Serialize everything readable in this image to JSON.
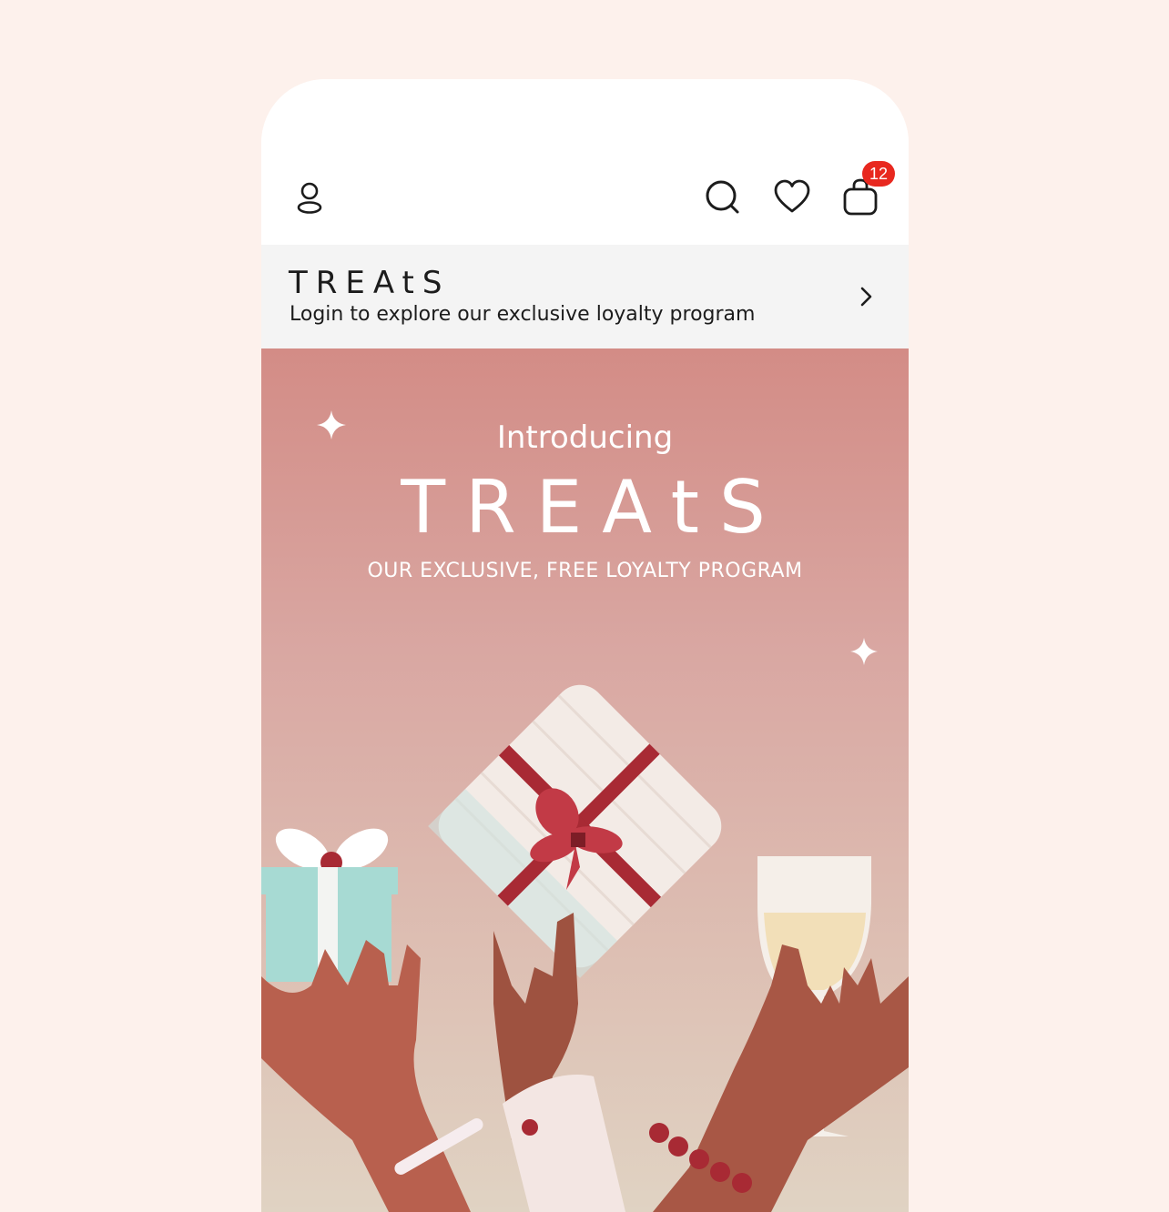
{
  "header": {
    "account_icon": "person-icon",
    "search_icon": "search-icon",
    "wishlist_icon": "heart-icon",
    "bag_icon": "shopping-bag-icon",
    "bag_count": "12"
  },
  "loyalty_bar": {
    "logo": "TREAtS",
    "text": "Login to explore our exclusive loyalty program",
    "chevron_icon": "chevron-right-icon"
  },
  "hero": {
    "intro": "Introducing",
    "brand": "TREAtS",
    "tagline": "OUR EXCLUSIVE, FREE LOYALTY PROGRAM",
    "illustration": "hands-holding-gifts-and-champagne"
  },
  "colors": {
    "page_background": "#fdf1ec",
    "badge": "#e8281f",
    "hero_top": "#d38c86",
    "hero_bottom": "#e0d3c3",
    "ribbon": "#a82a34"
  }
}
